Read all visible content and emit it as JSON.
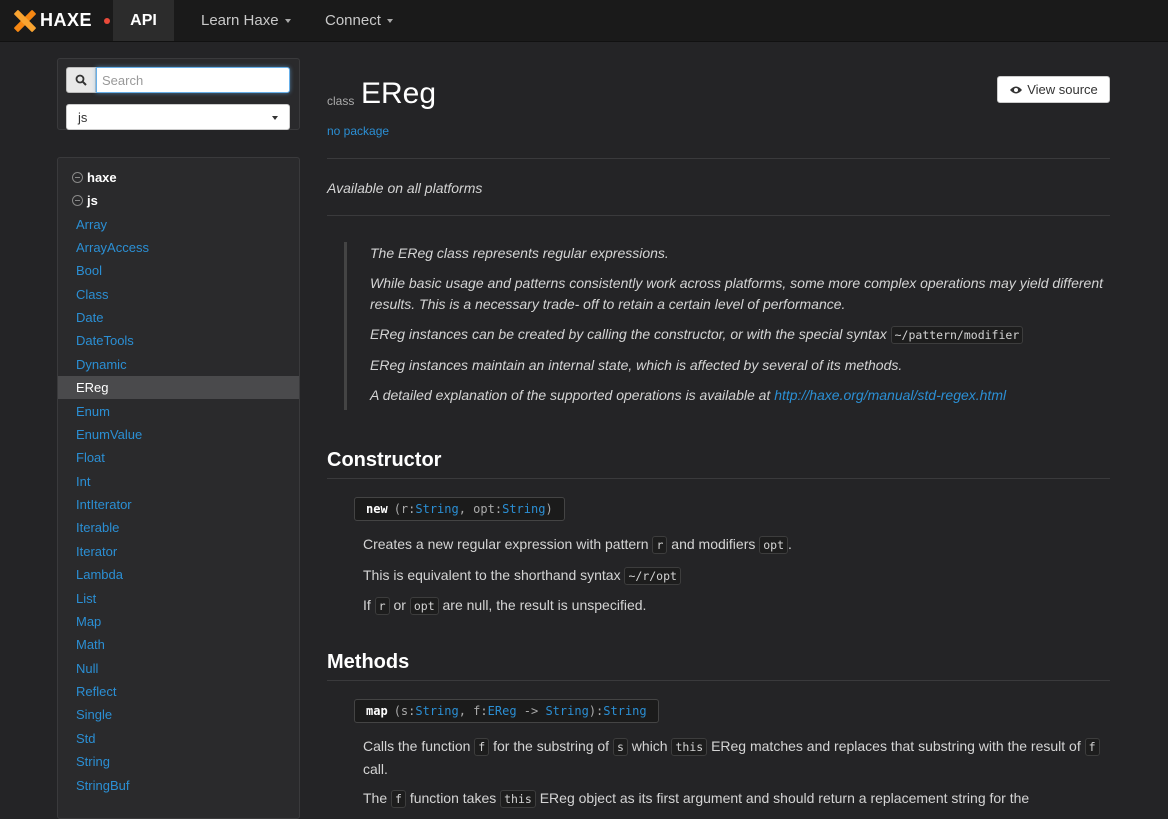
{
  "nav": {
    "logo_text": "HAXE",
    "api_label": "API",
    "learn_label": "Learn Haxe",
    "connect_label": "Connect"
  },
  "sidebar": {
    "search_placeholder": "Search",
    "platform": "js",
    "packages": [
      "haxe",
      "js"
    ],
    "types": [
      "Array",
      "ArrayAccess",
      "Bool",
      "Class",
      "Date",
      "DateTools",
      "Dynamic",
      "EReg",
      "Enum",
      "EnumValue",
      "Float",
      "Int",
      "IntIterator",
      "Iterable",
      "Iterator",
      "Lambda",
      "List",
      "Map",
      "Math",
      "Null",
      "Reflect",
      "Single",
      "Std",
      "String",
      "StringBuf"
    ],
    "active_type": "EReg"
  },
  "header": {
    "kind": "class",
    "name": "EReg",
    "package_link": "no package",
    "view_source_label": "View source"
  },
  "availability": "Available on all platforms",
  "description": {
    "p1": "The EReg class represents regular expressions.",
    "p2": "While basic usage and patterns consistently work across platforms, some more complex operations may yield different results. This is a necessary trade- off to retain a certain level of performance.",
    "p3_text": "EReg instances can be created by calling the constructor, or with the special syntax ",
    "p3_code": "~/pattern/modifier",
    "p4": "EReg instances maintain an internal state, which is affected by several of its methods.",
    "p5_text": "A detailed explanation of the supported operations is available at ",
    "p5_link": "http://haxe.org/manual/std-regex.html"
  },
  "constructor": {
    "heading": "Constructor",
    "sig_name": "new",
    "sig_open": "(r:",
    "sig_t1": "String",
    "sig_mid": ", opt:",
    "sig_t2": "String",
    "sig_close": ")",
    "l1_a": "Creates a new regular expression with pattern ",
    "l1_code1": "r",
    "l1_b": " and modifiers ",
    "l1_code2": "opt",
    "l1_c": ".",
    "l2_a": "This is equivalent to the shorthand syntax ",
    "l2_code": "~/r/opt",
    "l3_a": "If ",
    "l3_code1": "r",
    "l3_b": " or ",
    "l3_code2": "opt",
    "l3_c": " are null, the result is unspecified."
  },
  "methods": {
    "heading": "Methods",
    "sig_name": "map",
    "sig_open": "(s:",
    "sig_t1": "String",
    "sig_mid": ", f:",
    "sig_t2": "EReg",
    "sig_arrow": " -> ",
    "sig_t3": "String",
    "sig_close": "):",
    "sig_t4": "String",
    "m1_a": "Calls the function ",
    "m1_code1": "f",
    "m1_b": " for the substring of ",
    "m1_code2": "s",
    "m1_c": " which ",
    "m1_code3": "this",
    "m1_d": " EReg matches and replaces that substring with the result of ",
    "m1_code4": "f",
    "m1_e": " call.",
    "m2_a": "The ",
    "m2_code1": "f",
    "m2_b": " function takes ",
    "m2_code2": "this",
    "m2_c": " EReg object as its first argument and should return a replacement string for the"
  }
}
